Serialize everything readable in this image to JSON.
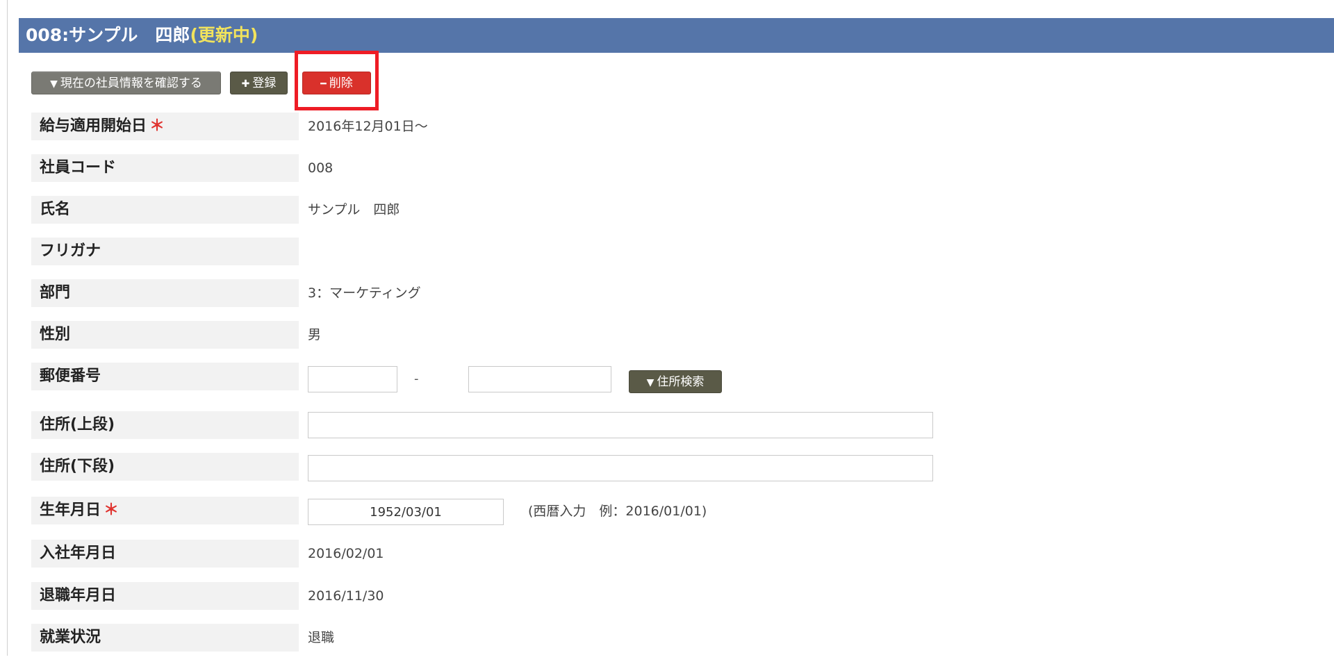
{
  "header": {
    "title": "008:サンプル　四郎",
    "status": "(更新中)"
  },
  "toolbar": {
    "confirm_label": "現在の社員情報を確認する",
    "register_label": "登録",
    "delete_label": "削除"
  },
  "icons": {
    "confirm": "triangle-down-icon",
    "register": "plus-icon",
    "delete": "minus-icon",
    "address_search": "triangle-down-icon"
  },
  "colors": {
    "header_bg": "#5575a9",
    "status_text": "#f2e35c",
    "delete_button": "#d9312b",
    "highlight": "#ee1c25",
    "required_mark": "#e0332f"
  },
  "required_mark": "＊",
  "fields": {
    "salary_start": {
      "label": "給与適用開始日",
      "value": "2016年12月01日～"
    },
    "employee_code": {
      "label": "社員コード",
      "value": "008"
    },
    "name": {
      "label": "氏名",
      "value": "サンプル　四郎"
    },
    "furigana": {
      "label": "フリガナ",
      "value": ""
    },
    "department": {
      "label": "部門",
      "value": "3：マーケティング"
    },
    "gender": {
      "label": "性別",
      "value": "男"
    },
    "postal_code": {
      "label": "郵便番号",
      "part1": "",
      "separator": "-",
      "part2": "",
      "search_label": "住所検索"
    },
    "address1": {
      "label": "住所(上段)",
      "value": ""
    },
    "address2": {
      "label": "住所(下段)",
      "value": ""
    },
    "birthdate": {
      "label": "生年月日",
      "value": "1952/03/01",
      "hint": "(西暦入力　例：2016/01/01)"
    },
    "hire_date": {
      "label": "入社年月日",
      "value": "2016/02/01"
    },
    "retirement_date": {
      "label": "退職年月日",
      "value": "2016/11/30"
    },
    "employment_status": {
      "label": "就業状況",
      "value": "退職"
    }
  }
}
